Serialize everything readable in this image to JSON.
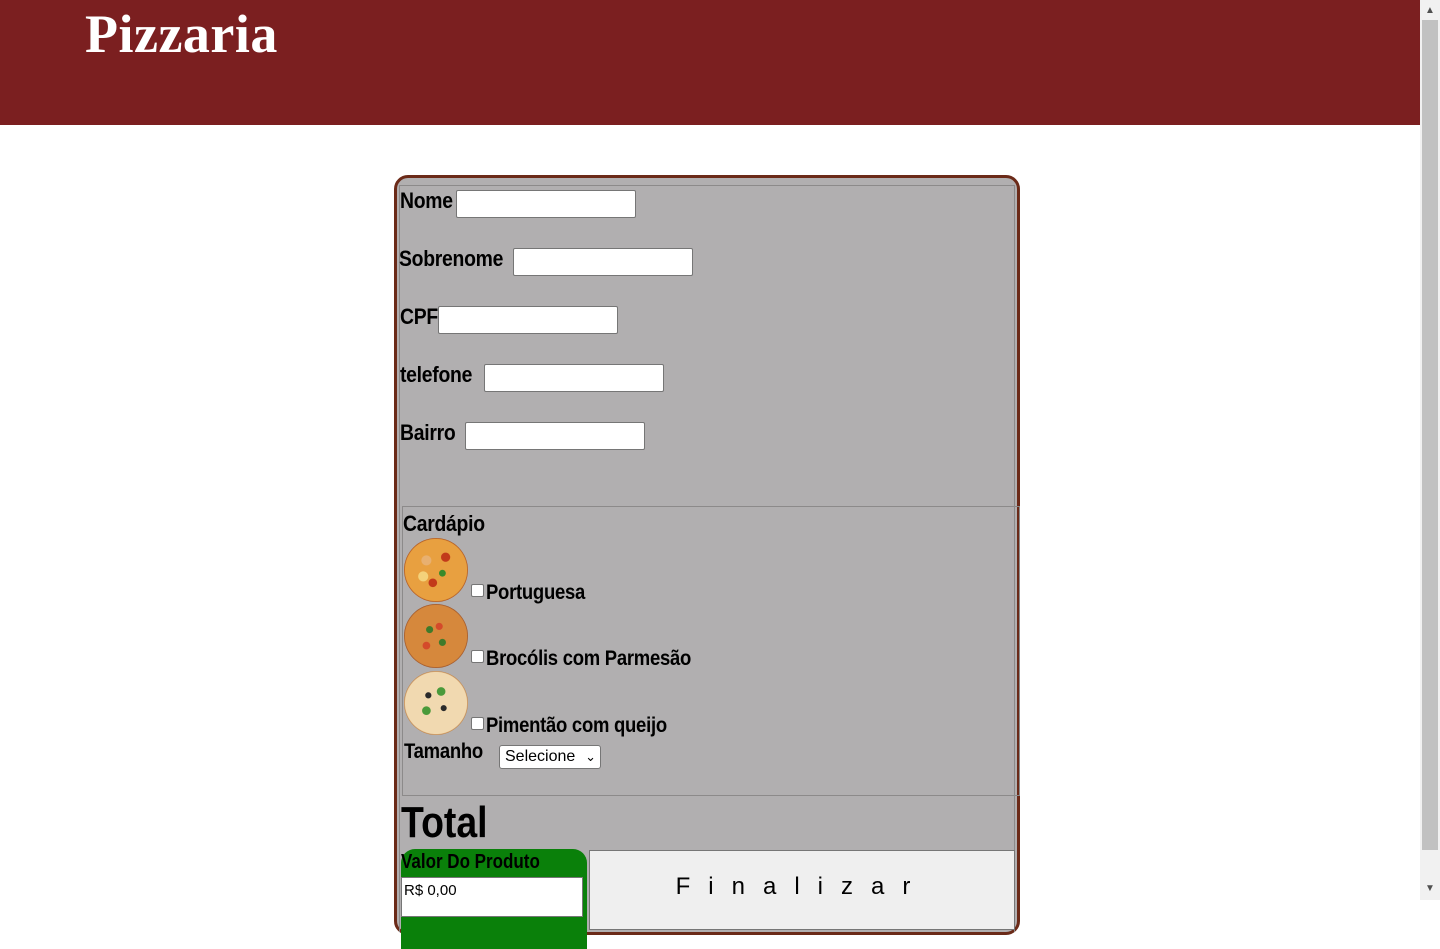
{
  "header": {
    "brand": "Pizzaria"
  },
  "form": {
    "fields": [
      {
        "label": "Nome",
        "value": ""
      },
      {
        "label": "Sobrenome",
        "value": ""
      },
      {
        "label": "CPF",
        "value": ""
      },
      {
        "label": "telefone",
        "value": ""
      },
      {
        "label": "Bairro",
        "value": ""
      }
    ],
    "menu": {
      "title": "Cardápio",
      "items": [
        {
          "label": "Portuguesa",
          "checked": false,
          "icon": "pizza-portuguesa-image"
        },
        {
          "label": "Brocólis com Parmesão",
          "checked": false,
          "icon": "pizza-brocolis-image"
        },
        {
          "label": "Pimentão com queijo",
          "checked": false,
          "icon": "pizza-pimentao-image"
        }
      ],
      "size_label": "Tamanho",
      "size_selected": "Selecione"
    },
    "total": {
      "title": "Total",
      "valor_label": "Valor Do Produto",
      "valor_value": "R$ 0,00"
    },
    "finalizar_label": "Finalizar"
  },
  "colors": {
    "header": "#7b1f20",
    "panel": "#b1afb0",
    "panel_border": "#6b2a18",
    "valor": "#0a800a"
  }
}
